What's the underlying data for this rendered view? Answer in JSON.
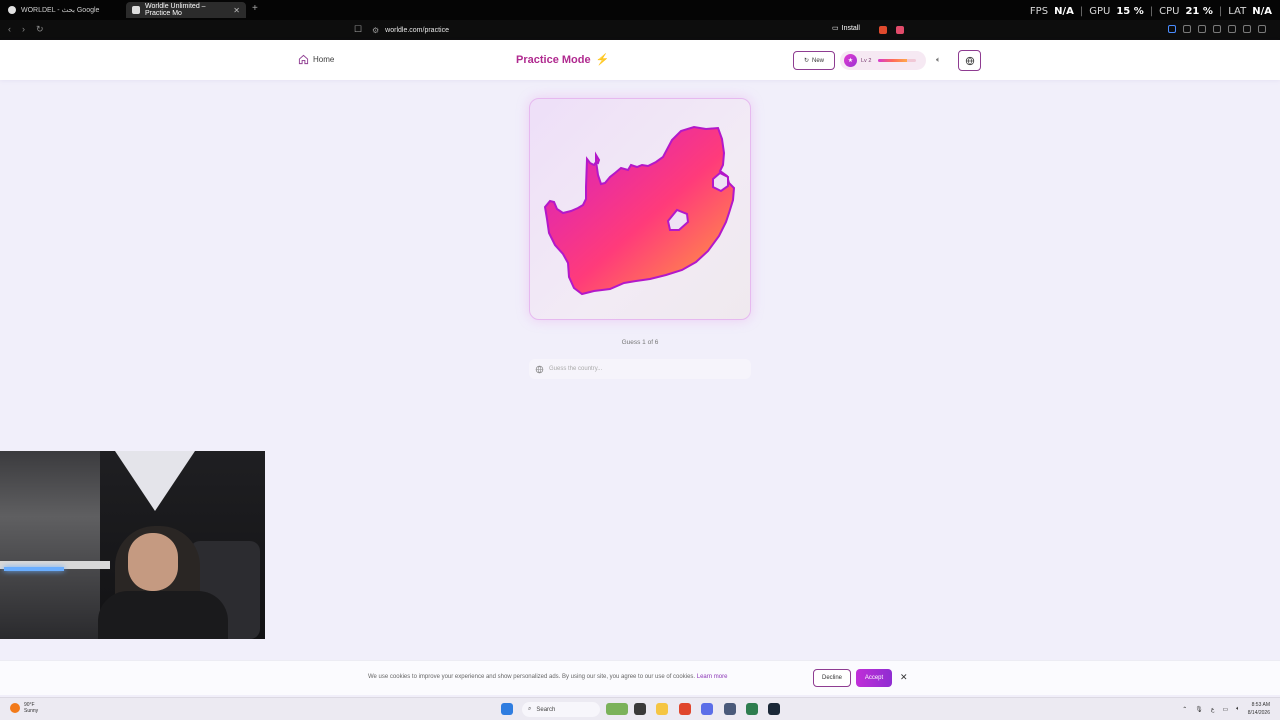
{
  "browser": {
    "tabs": [
      {
        "title": "WORLDEL - بحث Google",
        "active": false
      },
      {
        "title": "Worldle Unlimited – Practice Mo",
        "active": true
      }
    ],
    "url": "worldle.com/practice",
    "install_label": "Install",
    "perf": {
      "fps_label": "FPS",
      "fps_value": "N/A",
      "gpu_label": "GPU",
      "gpu_value": "15 %",
      "cpu_label": "CPU",
      "cpu_value": "21 %",
      "lat_label": "LAT",
      "lat_value": "N/A"
    }
  },
  "header": {
    "home_label": "Home",
    "title": "Practice Mode",
    "new_label": "New",
    "level_label": "Lv 2",
    "level_progress": 0.75
  },
  "game": {
    "guess_counter": "Guess 1 of 6",
    "input_placeholder": "Guess the country..."
  },
  "cookie": {
    "message": "We use cookies to improve your experience and show personalized ads. By using our site, you agree to our use of cookies.",
    "learn_more": "Learn more",
    "decline_label": "Decline",
    "accept_label": "Accept"
  },
  "taskbar": {
    "weather_temp": "90°F",
    "weather_desc": "Sunny",
    "search_label": "Search",
    "time": "8:53 AM",
    "date": "8/14/2026",
    "lang": "ع"
  },
  "colors": {
    "brand": "#b02a8f",
    "accent": "#c02ed8",
    "map_gradient": [
      "#d31fc8",
      "#ff3b7a",
      "#ffa33a"
    ]
  }
}
